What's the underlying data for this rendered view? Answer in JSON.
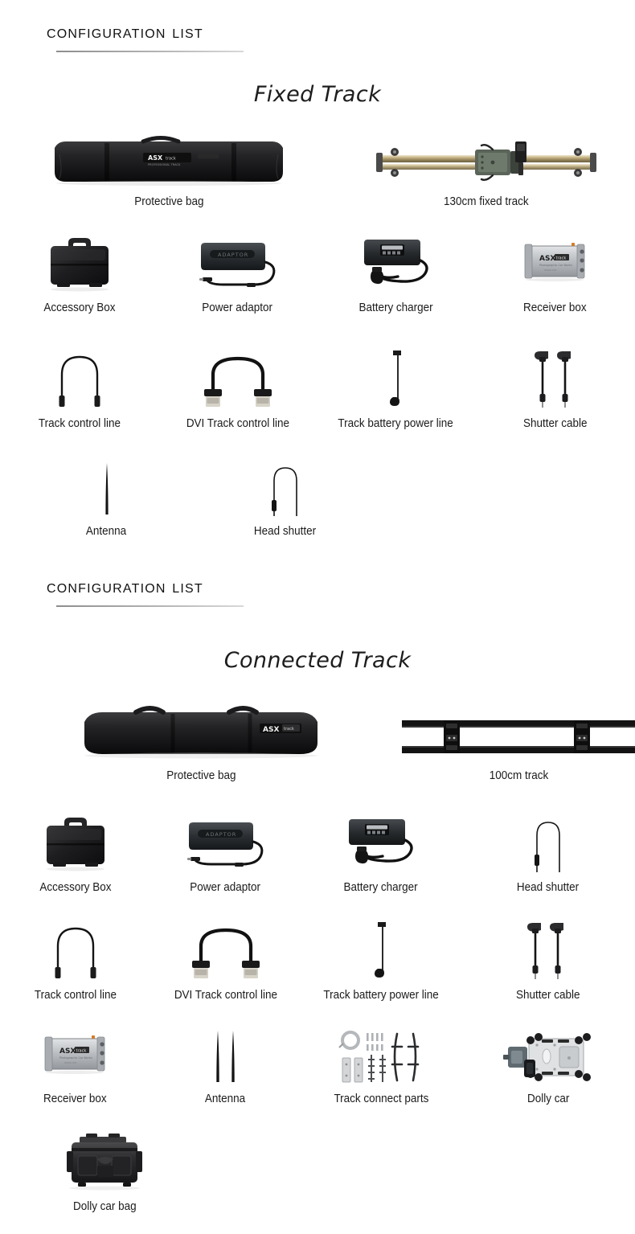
{
  "sections": [
    {
      "heading": "Configuration list",
      "subtitle": "Fixed Track",
      "rows": [
        {
          "items": [
            {
              "label": "Protective bag",
              "icon": "protective-bag-long"
            },
            {
              "label": "130cm fixed track",
              "icon": "fixed-track-rail"
            }
          ]
        },
        {
          "items": [
            {
              "label": "Accessory Box",
              "icon": "accessory-case"
            },
            {
              "label": "Power adaptor",
              "icon": "power-adaptor"
            },
            {
              "label": "Battery charger",
              "icon": "battery-charger"
            },
            {
              "label": "Receiver box",
              "icon": "receiver-box"
            }
          ]
        },
        {
          "items": [
            {
              "label": "Track control line",
              "icon": "control-line-cable"
            },
            {
              "label": "DVI Track control line",
              "icon": "dvi-cable"
            },
            {
              "label": "Track battery power line",
              "icon": "battery-power-line"
            },
            {
              "label": "Shutter cable",
              "icon": "shutter-cable"
            }
          ]
        },
        {
          "items": [
            {
              "label": "Antenna",
              "icon": "antenna-single"
            },
            {
              "label": "Head shutter",
              "icon": "head-shutter"
            }
          ]
        }
      ]
    },
    {
      "heading": "Configuration list",
      "subtitle": "Connected Track",
      "rows": [
        {
          "items": [
            {
              "label": "Protective bag",
              "icon": "protective-bag-short"
            },
            {
              "label": "100cm track",
              "icon": "connected-track-rail"
            }
          ]
        },
        {
          "items": [
            {
              "label": "Accessory Box",
              "icon": "accessory-case"
            },
            {
              "label": "Power adaptor",
              "icon": "power-adaptor"
            },
            {
              "label": "Battery charger",
              "icon": "battery-charger"
            },
            {
              "label": "Head shutter",
              "icon": "head-shutter"
            }
          ]
        },
        {
          "items": [
            {
              "label": "Track control line",
              "icon": "control-line-cable"
            },
            {
              "label": "DVI Track control line",
              "icon": "dvi-cable"
            },
            {
              "label": "Track battery power line",
              "icon": "battery-power-line"
            },
            {
              "label": "Shutter cable",
              "icon": "shutter-cable"
            }
          ]
        },
        {
          "items": [
            {
              "label": "Receiver box",
              "icon": "receiver-box"
            },
            {
              "label": "Antenna",
              "icon": "antenna-double"
            },
            {
              "label": "Track connect parts",
              "icon": "track-connect-parts"
            },
            {
              "label": "Dolly car",
              "icon": "dolly-car"
            }
          ]
        },
        {
          "items": [
            {
              "label": "Dolly car bag",
              "icon": "dolly-car-bag"
            }
          ]
        }
      ]
    }
  ],
  "colors": {
    "background": "#ffffff",
    "text": "#1a1a1a",
    "rule": "#9a9a9a",
    "product_black": "#1c1c1c",
    "metal_silver": "#b9bcc0",
    "rail_gold": "#b9a879"
  }
}
